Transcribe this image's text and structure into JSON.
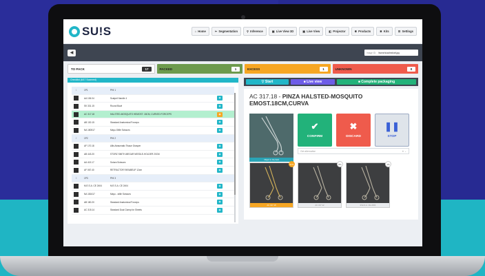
{
  "app": {
    "logo_text": "SU!S"
  },
  "nav": [
    {
      "icon": "home-icon",
      "glyph": "⌂",
      "label": "Home"
    },
    {
      "icon": "segmentation-icon",
      "glyph": "✂",
      "label": "Segmentation"
    },
    {
      "icon": "inference-icon",
      "glyph": "⚲",
      "label": "Inference"
    },
    {
      "icon": "liveview-3d-icon",
      "glyph": "▣",
      "label": "Live View 3D"
    },
    {
      "icon": "liveview-icon",
      "glyph": "▣",
      "label": "Live View"
    },
    {
      "icon": "projector-icon",
      "glyph": "◧",
      "label": "Projector"
    },
    {
      "icon": "products-icon",
      "glyph": "✱",
      "label": "Products"
    },
    {
      "icon": "kits-icon",
      "glyph": "✱",
      "label": "Kits"
    },
    {
      "icon": "settings-icon",
      "glyph": "☰",
      "label": "Settings"
    }
  ],
  "toolbar": {
    "back_glyph": "◀",
    "image_label": "Image ID:",
    "image_value": "/home/sius/test/att.jpg"
  },
  "status": {
    "topack": {
      "label": "TO PACK",
      "count": "17"
    },
    "packed": {
      "label": "PACKED",
      "count": "1"
    },
    "excess": {
      "label": "EXCESS",
      "count": "1"
    },
    "unknown": {
      "label": "UNKNOWN",
      "count": "0"
    }
  },
  "checklist": {
    "title": "Checklist (6/17 Scanned)",
    "rows": [
      {
        "type": "group",
        "no": "1",
        "code": "1P1",
        "name": "PHI 1"
      },
      {
        "type": "item",
        "code": "AA 106.04",
        "name": "Scalpel Handle 4"
      },
      {
        "type": "item",
        "code": "SK 331.15",
        "name": "Round Bowl"
      },
      {
        "type": "item",
        "active": true,
        "code": "AC 317.18",
        "name": "HALSTED-MOSQUITO HEMOST. 18CM, CURVED FORCEPS"
      },
      {
        "type": "item",
        "code": "AB 130.15",
        "name": "Standard Anatomical Forceps"
      },
      {
        "type": "item",
        "code": "NA 180517",
        "name": "Mayo-Stille Scissors"
      },
      {
        "type": "group",
        "no": "2",
        "code": "1P2",
        "name": "PHI 2"
      },
      {
        "type": "item",
        "code": "AF 170.18",
        "name": "Allis Atraumatic Tissue Grasper"
      },
      {
        "type": "item",
        "code": "AB 443.20",
        "name": "STORZ SMITH-MEGAR NEEDLE-HOLDER 20CM"
      },
      {
        "type": "item",
        "code": "AA 413.17",
        "name": "Sutura Scissors"
      },
      {
        "type": "item",
        "code": "AF 067.40",
        "name": "RETRACTOR FARABEUF 12cm"
      },
      {
        "type": "group",
        "no": "3",
        "code": "1P3",
        "name": "PHI 3"
      },
      {
        "type": "item",
        "code": "M.E.S.A. CE 2404",
        "name": "M.E.S.A. CE 2404"
      },
      {
        "type": "item",
        "code": "NA 181617",
        "name": "Mayo - stille Scissors"
      },
      {
        "type": "item",
        "code": "AB 180.20",
        "name": "Standard Anatomical Forceps"
      },
      {
        "type": "item",
        "code": "AC 315.14",
        "name": "Standard Dual Clamp for Sheets"
      }
    ]
  },
  "actions": {
    "start": "▽ Start",
    "live": "■ Live view",
    "complete": "■ Complete packaging"
  },
  "product": {
    "code": "AC 317.18 -",
    "name": "PINZA HALSTED-MOSQUITO EMOST.18CM,CURVA",
    "img_caption": "Object in the field",
    "confirm": "CONFIRM",
    "discard": "DISCARD",
    "stop": "STOP",
    "alt_placeholder": "Get alternative"
  },
  "candidates": [
    {
      "pct": "91%",
      "caption": "AC 317.18"
    },
    {
      "pct": "8%",
      "caption": "AC 317.12"
    },
    {
      "pct": "1%",
      "caption": "M.E.S.A. CE 2404"
    }
  ]
}
